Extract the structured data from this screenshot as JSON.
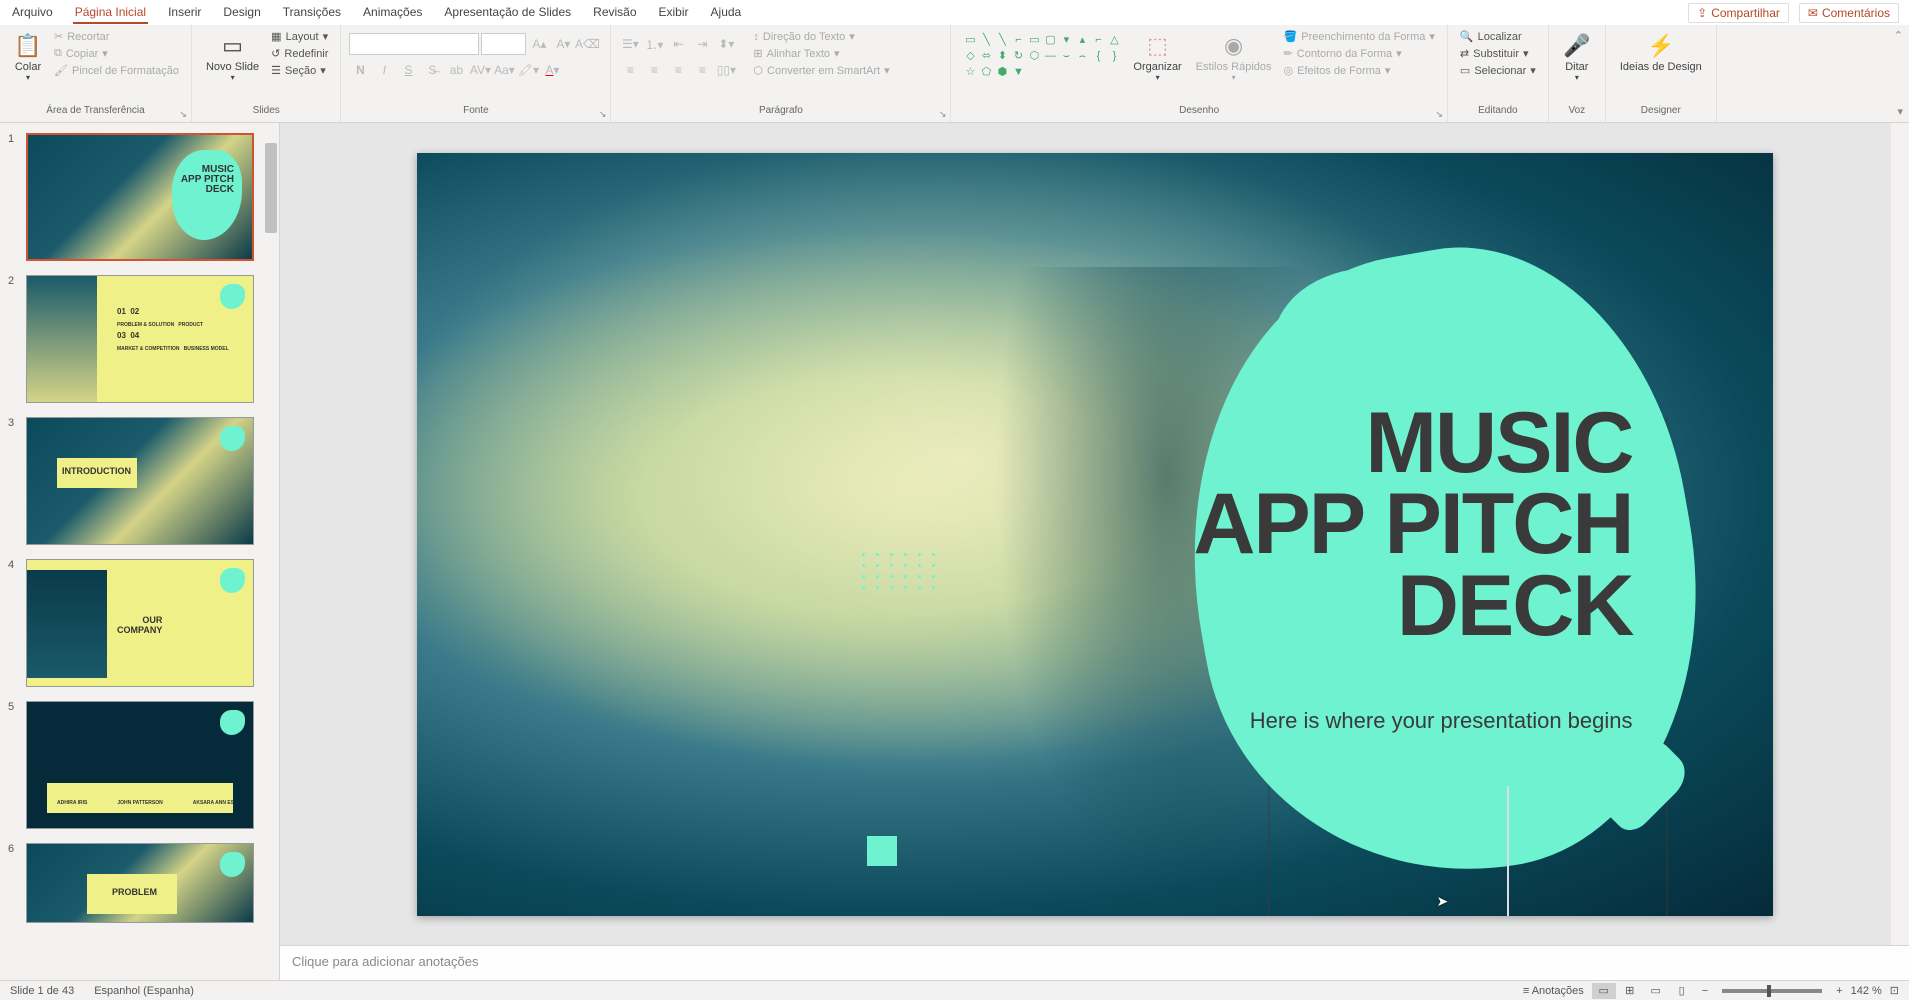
{
  "menubar": {
    "items": [
      "Arquivo",
      "Página Inicial",
      "Inserir",
      "Design",
      "Transições",
      "Animações",
      "Apresentação de Slides",
      "Revisão",
      "Exibir",
      "Ajuda"
    ],
    "active_index": 1,
    "share_label": "Compartilhar",
    "comments_label": "Comentários"
  },
  "ribbon": {
    "clipboard": {
      "paste": "Colar",
      "cut": "Recortar",
      "copy": "Copiar",
      "format_painter": "Pincel de Formatação",
      "label": "Área de Transferência"
    },
    "slides": {
      "new_slide": "Novo Slide",
      "layout": "Layout",
      "reset": "Redefinir",
      "section": "Seção",
      "label": "Slides"
    },
    "font": {
      "label": "Fonte"
    },
    "paragraph": {
      "text_direction": "Direção do Texto",
      "align_text": "Alinhar Texto",
      "convert_smartart": "Converter em SmartArt",
      "label": "Parágrafo"
    },
    "drawing": {
      "arrange": "Organizar",
      "quick_styles": "Estilos Rápidos",
      "shape_fill": "Preenchimento da Forma",
      "shape_outline": "Contorno da Forma",
      "shape_effects": "Efeitos de Forma",
      "label": "Desenho"
    },
    "editing": {
      "find": "Localizar",
      "replace": "Substituir",
      "select": "Selecionar",
      "label": "Editando"
    },
    "voice": {
      "dictate": "Ditar",
      "label": "Voz"
    },
    "designer": {
      "ideas": "Ideias de Design",
      "label": "Designer"
    }
  },
  "slides": {
    "items": [
      {
        "num": "1",
        "title": "MUSIC APP PITCH DECK",
        "bg": "teal"
      },
      {
        "num": "2",
        "title": "01 02 03 04",
        "bg": "yellow"
      },
      {
        "num": "3",
        "title": "INTRODUCTION",
        "bg": "teal"
      },
      {
        "num": "4",
        "title": "OUR COMPANY",
        "bg": "yellow"
      },
      {
        "num": "5",
        "title": "",
        "bg": "teal"
      },
      {
        "num": "6",
        "title": "PROBLEM",
        "bg": "teal"
      }
    ]
  },
  "main_slide": {
    "title_line1": "MUSIC",
    "title_line2": "APP PITCH",
    "title_line3": "DECK",
    "subtitle": "Here is where your presentation begins"
  },
  "notes": {
    "placeholder": "Clique para adicionar anotações"
  },
  "statusbar": {
    "slide_info": "Slide 1 de 43",
    "language": "Espanhol (Espanha)",
    "notes_btn": "Anotações",
    "zoom": "142 %"
  }
}
